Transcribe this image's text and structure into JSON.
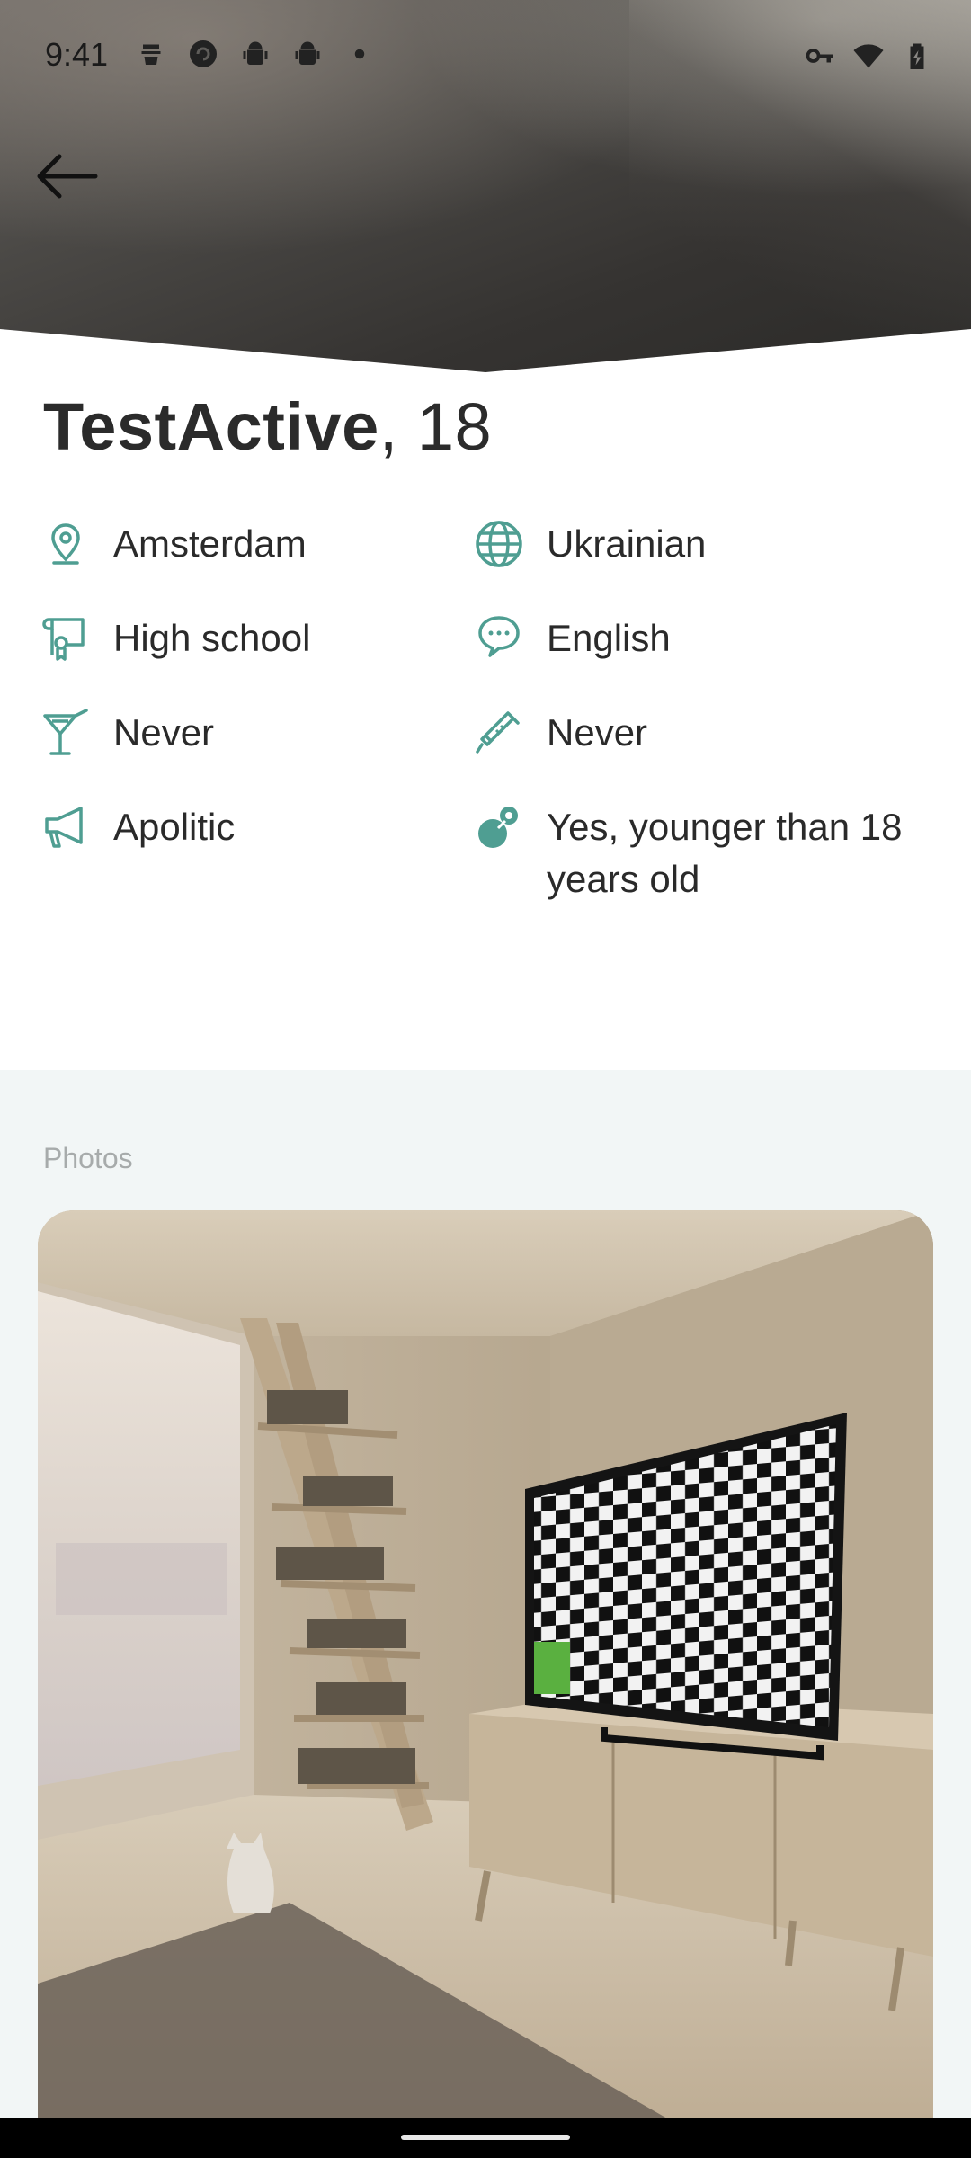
{
  "status_bar": {
    "time": "9:41",
    "left_icons": [
      "lookout-icon",
      "sync-icon",
      "android-icon",
      "android-icon",
      "dot-icon"
    ],
    "right_icons": [
      "key-icon",
      "wifi-icon",
      "battery-charging-icon"
    ]
  },
  "header": {
    "back_icon": "arrow-left-icon"
  },
  "profile": {
    "name": "TestActive",
    "age_text": ", 18",
    "details": [
      {
        "icon": "location-pin-icon",
        "label": "Amsterdam"
      },
      {
        "icon": "globe-icon",
        "label": "Ukrainian"
      },
      {
        "icon": "diploma-icon",
        "label": "High school"
      },
      {
        "icon": "chat-bubbles-icon",
        "label": "English"
      },
      {
        "icon": "cocktail-icon",
        "label": "Never"
      },
      {
        "icon": "syringe-icon",
        "label": "Never"
      },
      {
        "icon": "megaphone-icon",
        "label": "Apolitic"
      },
      {
        "icon": "pacifier-icon",
        "label": "Yes, younger than 18 years old"
      }
    ]
  },
  "photos": {
    "section_title": "Photos"
  },
  "colors": {
    "accent": "#4f9e92",
    "text": "#2a2a2a",
    "muted": "#a7abab",
    "section_bg": "#f2f6f6"
  }
}
